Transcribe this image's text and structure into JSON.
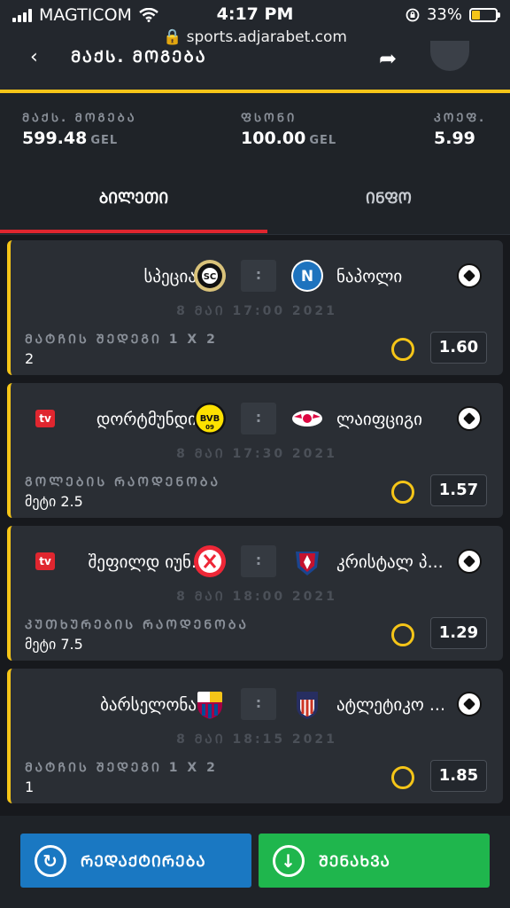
{
  "status_bar": {
    "carrier": "MAGTICOM",
    "time": "4:17 PM",
    "battery": "33%",
    "url": "sports.adjarabet.com"
  },
  "header": {
    "title": "ᲛᲐᲥᲡ. ᲛᲝᲒᲔᲑᲐ"
  },
  "summary": {
    "max_win_label": "ᲛᲐᲥᲡ. ᲛᲝᲒᲔᲑᲐ",
    "max_win_value": "599.48",
    "max_win_unit": "GEL",
    "stake_label": "ᲤᲡᲝᲜᲘ",
    "stake_value": "100.00",
    "stake_unit": "GEL",
    "coef_label": "ᲙᲝᲔᲤ.",
    "coef_value": "5.99"
  },
  "tabs": {
    "ticket": "ᲑᲘᲚᲔᲗᲘ",
    "info": "ᲘᲜᲤᲝ"
  },
  "bets": [
    {
      "home": "სპეცია",
      "away": "ნაპოლი",
      "tv": "",
      "datetime": "8 ᲛᲐᲘ 17:00 2021",
      "market": "ᲛᲐᲢᲩᲘᲡ ᲨᲔᲓᲔᲒᲘ 1 X 2",
      "pick": "2",
      "odds": "1.60",
      "score_sep": ":"
    },
    {
      "home": "დორტმუნდი",
      "away": "ლაიფციგი",
      "tv": "tv",
      "datetime": "8 ᲛᲐᲘ 17:30 2021",
      "market": "ᲒᲝᲚᲔᲑᲘᲡ ᲠᲐᲝᲓᲔᲜᲝᲑᲐ",
      "pick": "მეტი 2.5",
      "odds": "1.57",
      "score_sep": ":"
    },
    {
      "home": "შეფილდ იუნ.",
      "away": "კრისტალ პ...",
      "tv": "tv",
      "datetime": "8 ᲛᲐᲘ 18:00 2021",
      "market": "ᲙᲣᲗᲮᲣᲠᲔᲑᲘᲡ ᲠᲐᲝᲓᲔᲜᲝᲑᲐ",
      "pick": "მეტი 7.5",
      "odds": "1.29",
      "score_sep": ":"
    },
    {
      "home": "ბარსელონა",
      "away": "ატლეტიკო ...",
      "tv": "",
      "datetime": "8 ᲛᲐᲘ 18:15 2021",
      "market": "ᲛᲐᲢᲩᲘᲡ ᲨᲔᲓᲔᲒᲘ 1 X 2",
      "pick": "1",
      "odds": "1.85",
      "score_sep": ":"
    }
  ],
  "footer": {
    "edit": "ᲠᲔᲓᲐᲥᲢᲘᲠᲔᲑᲐ",
    "save": "ᲨᲔᲜᲐᲮᲕᲐ"
  },
  "colors": {
    "accent_yellow": "#f5c518",
    "tab_red": "#e0262f",
    "edit_blue": "#1a78c2",
    "save_green": "#1fb64d"
  }
}
